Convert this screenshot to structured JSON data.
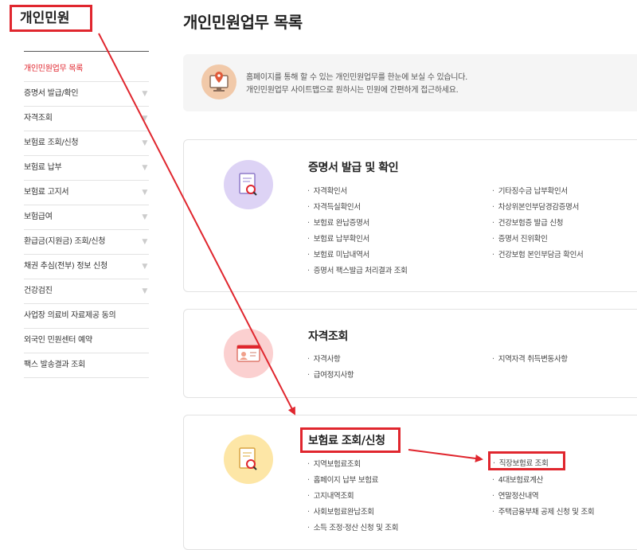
{
  "sidebar": {
    "title": "개인민원",
    "items": [
      {
        "label": "개인민원업무 목록",
        "active": true,
        "chevron": false
      },
      {
        "label": "증명서 발급/확인",
        "chevron": true
      },
      {
        "label": "자격조회",
        "chevron": true
      },
      {
        "label": "보험료 조회/신청",
        "chevron": true
      },
      {
        "label": "보험료 납부",
        "chevron": true
      },
      {
        "label": "보험료 고지서",
        "chevron": true
      },
      {
        "label": "보험급여",
        "chevron": true
      },
      {
        "label": "환급금(지원금) 조회/신청",
        "chevron": true
      },
      {
        "label": "채권 추심(전부) 정보 신청",
        "chevron": true
      },
      {
        "label": "건강검진",
        "chevron": true
      },
      {
        "label": "사업장 의료비 자료제공 동의",
        "chevron": false
      },
      {
        "label": "외국인 민원센터 예약",
        "chevron": false
      },
      {
        "label": "팩스 발송결과 조회",
        "chevron": false
      }
    ],
    "chevron_glyph": "▼"
  },
  "main": {
    "title": "개인민원업무 목록",
    "info": {
      "line1": "홈페이지를 통해 할 수 있는 개인민원업무를 한눈에 보실 수 있습니다.",
      "line2": "개인민원업무 사이트맵으로 원하시는 민원에 간편하게 접근하세요."
    },
    "sections": [
      {
        "title": "증명서 발급 및 확인",
        "left": [
          "자격확인서",
          "자격득실확인서",
          "보험료 완납증명서",
          "보험료 납부확인서",
          "보험료 미납내역서",
          "증명서 팩스발급 처리결과 조회"
        ],
        "right": [
          "기타징수금 납부확인서",
          "차상위본인부담경감증명서",
          "건강보험증 발급 신청",
          "증명서 진위확인",
          "건강보험 본인부담금 확인서"
        ]
      },
      {
        "title": "자격조회",
        "left": [
          "자격사항",
          "급여정지사항"
        ],
        "right": [
          "지역자격 취득변동사항"
        ]
      },
      {
        "title": "보험료 조회/신청",
        "left": [
          "지역보험료조회",
          "홈페이지 납부 보험료",
          "고지내역조회",
          "사회보험료완납조회",
          "소득 조정·정산 신청 및 조회"
        ],
        "right": [
          "직장보험료 조회",
          "4대보험료계산",
          "연말정산내역",
          "주택금융부채 공제 신청 및 조회"
        ]
      }
    ]
  },
  "colors": {
    "accent": "#e0262e",
    "icon_purple": "#ddd3f5",
    "icon_pink": "#fbd0d0",
    "icon_yellow": "#fde6a6",
    "info_icon": "#f1c9a9"
  }
}
